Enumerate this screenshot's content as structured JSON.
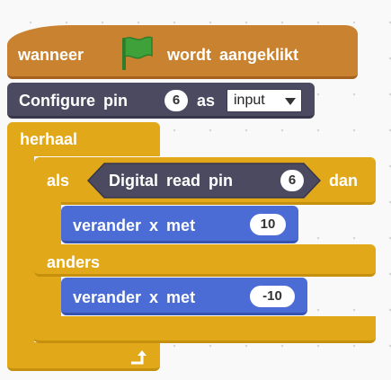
{
  "script": {
    "hat": {
      "before_flag": "wanneer",
      "after_flag": "wordt aangeklikt",
      "flag_color": "#3fa13a"
    },
    "configure": {
      "label_before": "Configure pin",
      "pin": "6",
      "label_as": "as",
      "mode": "input"
    },
    "repeat": {
      "label": "herhaal",
      "icon": "arrow-loop-icon"
    },
    "if_else": {
      "if_label": "als",
      "condition": {
        "label": "Digital read pin",
        "pin": "6"
      },
      "then_label": "dan",
      "then_block": {
        "label": "verander x met",
        "value": "10"
      },
      "else_label": "anders",
      "else_block": {
        "label": "verander x met",
        "value": "-10"
      }
    }
  },
  "colors": {
    "events": "#c88230",
    "robot": "#4b4a60",
    "control": "#e1a91a",
    "motion": "#4a6cd4",
    "background": "#f9f9f9"
  }
}
